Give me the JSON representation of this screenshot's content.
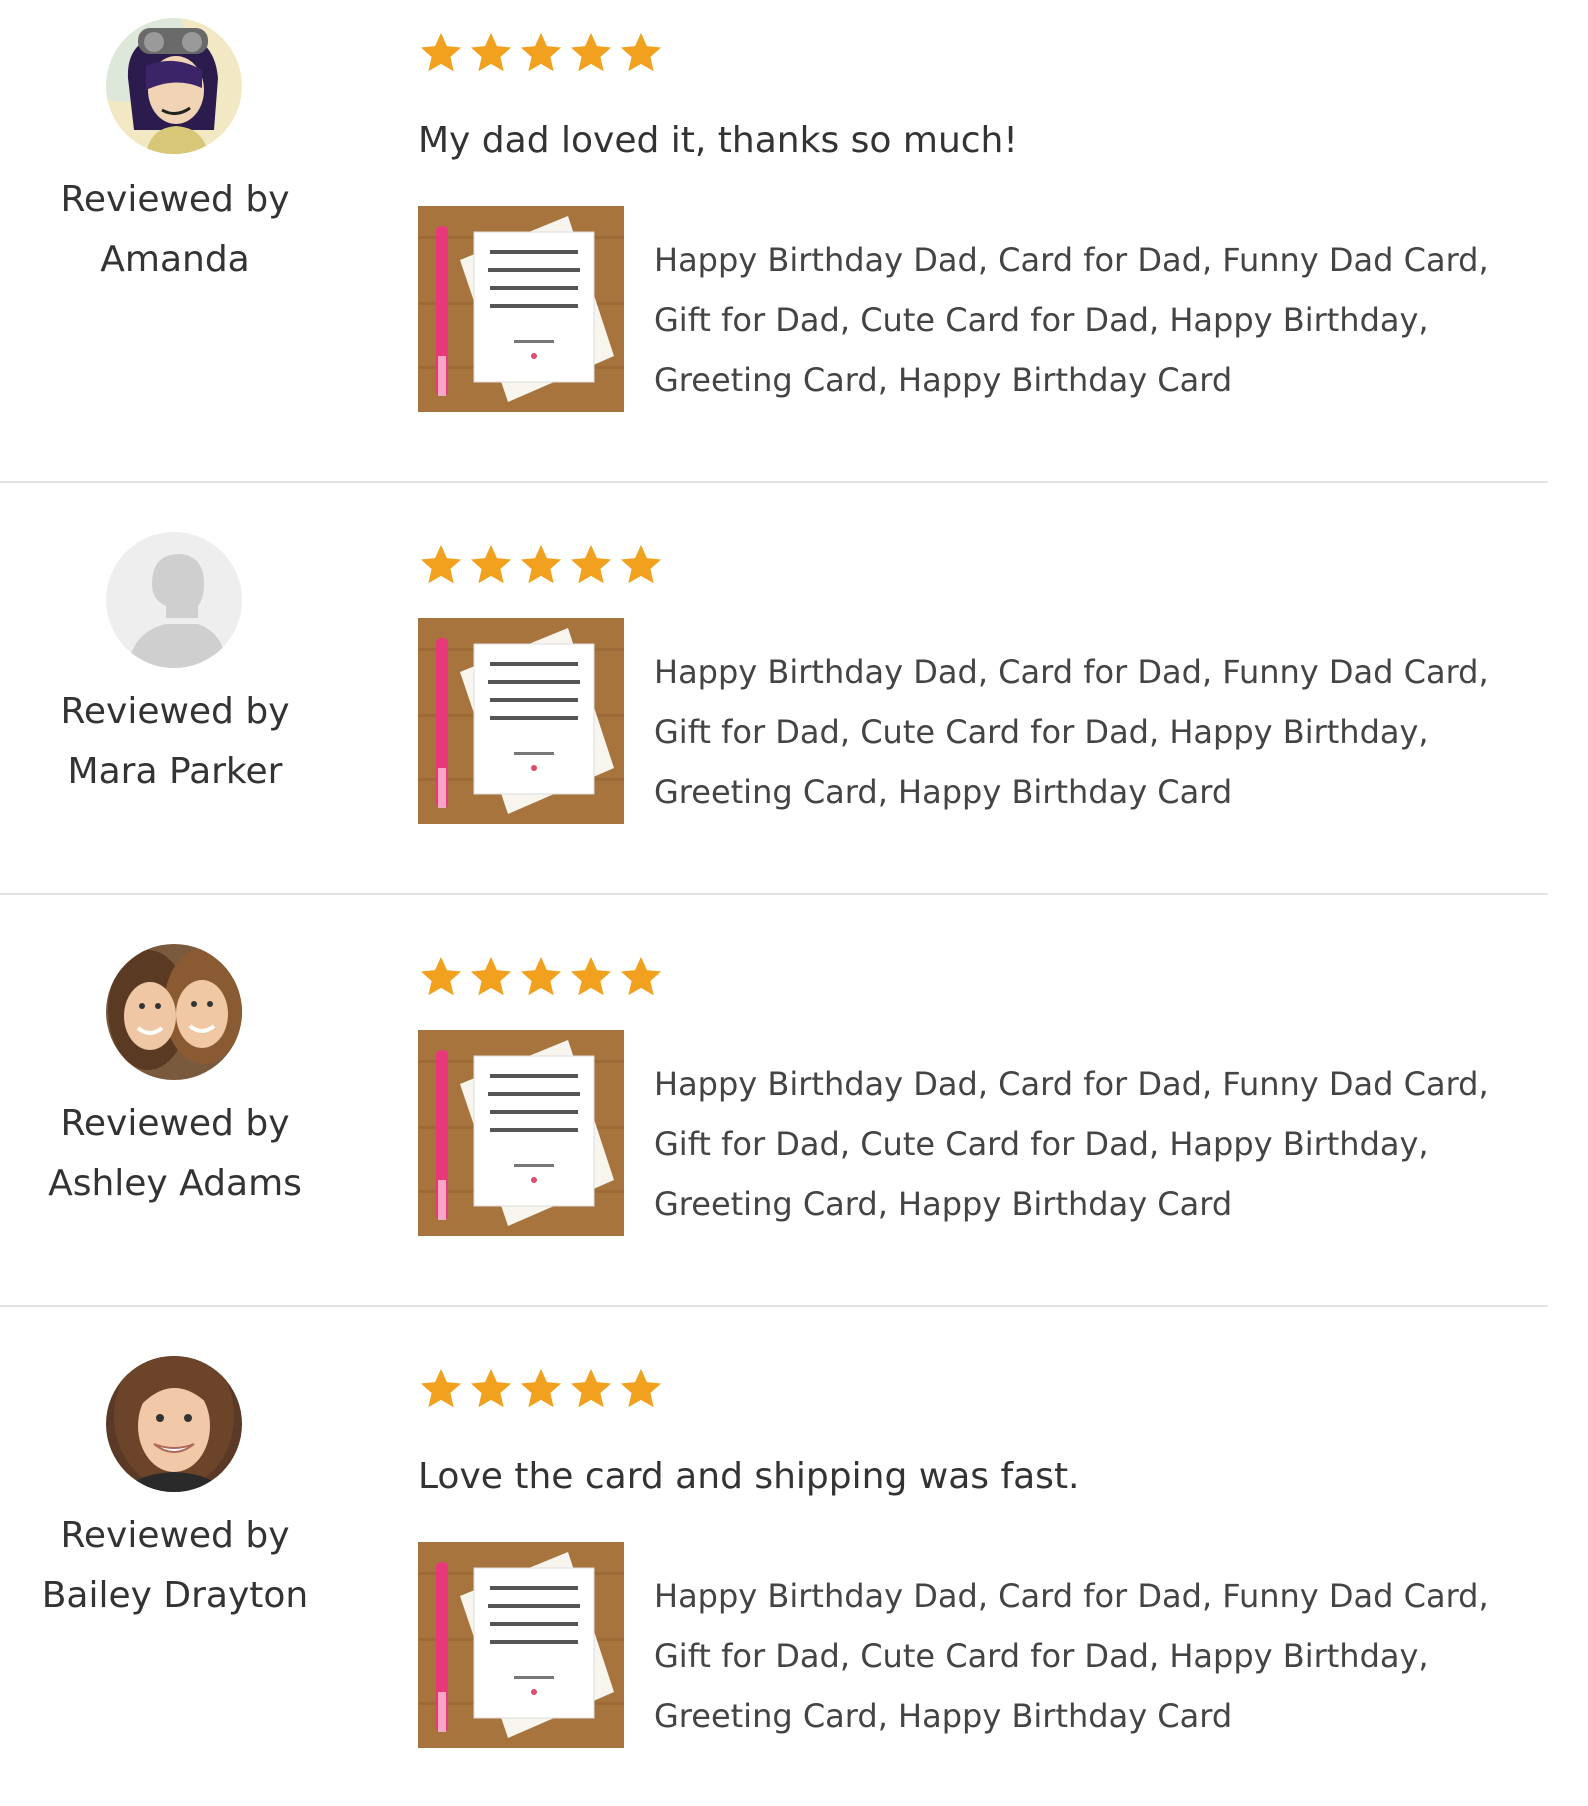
{
  "reviews": [
    {
      "reviewer_prefix": "Reviewed by",
      "reviewer_name": "Amanda",
      "avatar": "cartoon-avatar",
      "rating": 5,
      "comment": "My dad loved it, thanks so much!",
      "product_title": "Happy Birthday Dad, Card for Dad, Funny Dad Card, Gift for Dad, Cute Card for Dad, Happy Birthday, Greeting Card, Happy Birthday Card"
    },
    {
      "reviewer_prefix": "Reviewed by",
      "reviewer_name": "Mara Parker",
      "avatar": "default-user-icon",
      "rating": 5,
      "comment": "",
      "product_title": "Happy Birthday Dad, Card for Dad, Funny Dad Card, Gift for Dad, Cute Card for Dad, Happy Birthday, Greeting Card, Happy Birthday Card"
    },
    {
      "reviewer_prefix": "Reviewed by",
      "reviewer_name": "Ashley Adams",
      "avatar": "photo-avatar",
      "rating": 5,
      "comment": "",
      "product_title": "Happy Birthday Dad, Card for Dad, Funny Dad Card, Gift for Dad, Cute Card for Dad, Happy Birthday, Greeting Card, Happy Birthday Card"
    },
    {
      "reviewer_prefix": "Reviewed by",
      "reviewer_name": "Bailey Drayton",
      "avatar": "photo-avatar",
      "rating": 5,
      "comment": "Love the card and shipping was fast.",
      "product_title": "Happy Birthday Dad, Card for Dad, Funny Dad Card, Gift for Dad, Cute Card for Dad, Happy Birthday, Greeting Card, Happy Birthday Card"
    }
  ],
  "colors": {
    "star": "#F1A11E",
    "text": "#333333",
    "divider": "#E4E4E4"
  },
  "icons": {
    "star": "star-icon",
    "product_thumbnail": "greeting-card-thumbnail"
  }
}
